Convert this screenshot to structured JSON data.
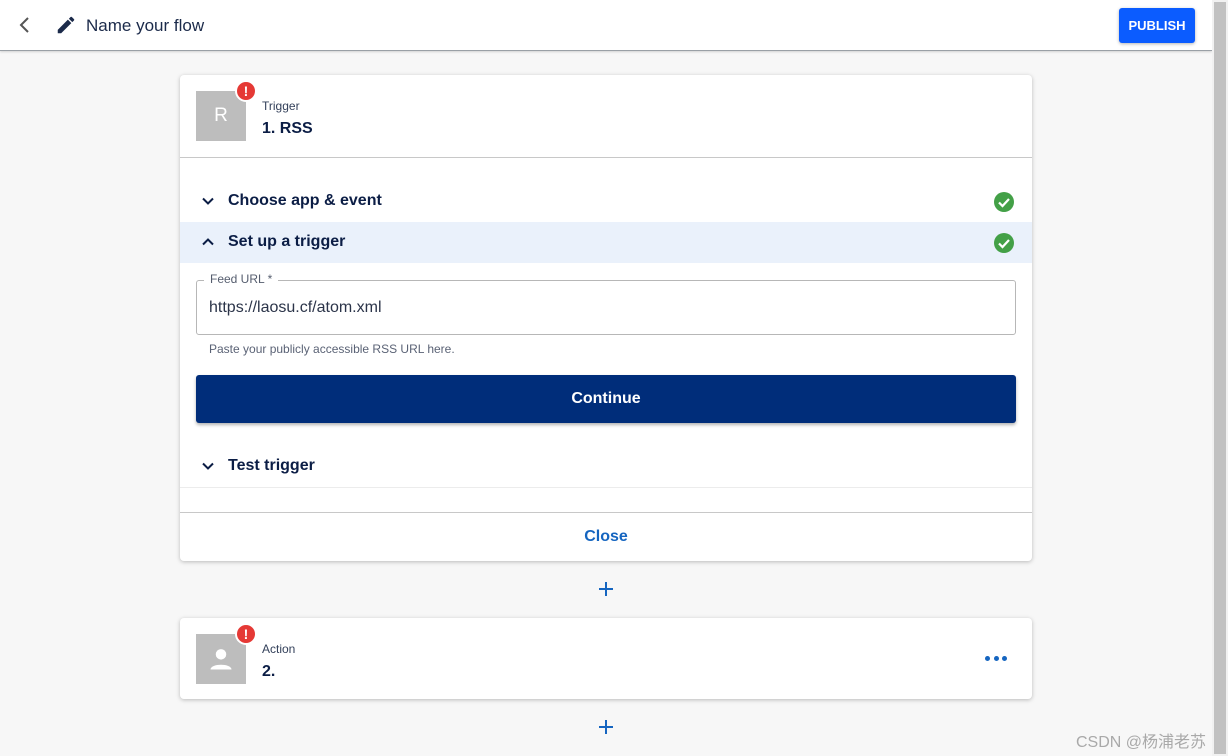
{
  "header": {
    "flow_name": "Name your flow",
    "publish_label": "PUBLISH"
  },
  "trigger_card": {
    "avatar_letter": "R",
    "badge": "!",
    "kind": "Trigger",
    "title": "1. RSS",
    "sections": [
      {
        "label": "Choose app & event",
        "expanded": false,
        "complete": true
      },
      {
        "label": "Set up a trigger",
        "expanded": true,
        "complete": true
      },
      {
        "label": "Test trigger",
        "expanded": false,
        "complete": false
      }
    ],
    "feed_url": {
      "label": "Feed URL *",
      "value": "https://laosu.cf/atom.xml",
      "helper": "Paste your publicly accessible RSS URL here."
    },
    "continue_label": "Continue",
    "close_label": "Close"
  },
  "action_card": {
    "badge": "!",
    "kind": "Action",
    "title": "2."
  },
  "watermark": "CSDN @杨浦老苏",
  "colors": {
    "primary": "#0b5cff",
    "continue": "#002d7a",
    "link": "#1565c0",
    "success": "#43a047",
    "error": "#e53935",
    "active_row": "#eaf1fb"
  }
}
